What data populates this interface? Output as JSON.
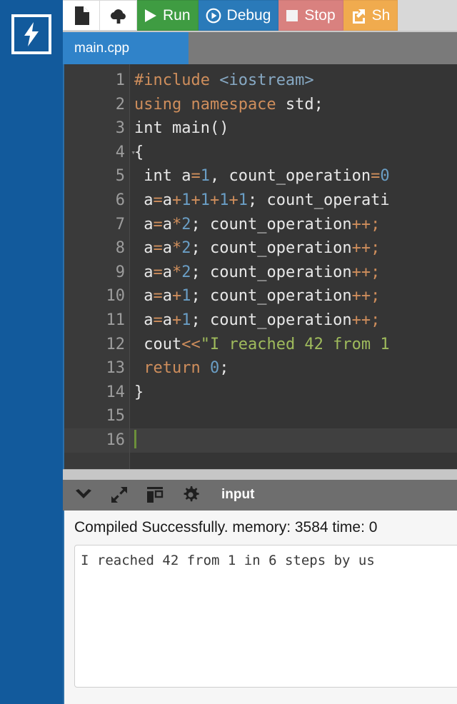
{
  "app": {
    "logo_icon": "lightning-bolt-icon",
    "sidebar_color": "#125a9c"
  },
  "toolbar": {
    "new_file_icon": "new-file-icon",
    "upload_icon": "cloud-upload-icon",
    "run_label": "Run",
    "run_icon": "play-icon",
    "run_color": "#3f9c42",
    "debug_label": "Debug",
    "debug_icon": "debug-circle-play-icon",
    "debug_color": "#2a7ab9",
    "stop_label": "Stop",
    "stop_icon": "stop-square-icon",
    "stop_color": "#d9817f",
    "share_label": "Sh",
    "share_icon": "share-external-icon",
    "share_color": "#f0ab4e"
  },
  "tabs": [
    {
      "label": "main.cpp",
      "active": true
    }
  ],
  "editor": {
    "lines": [
      {
        "num": "1",
        "fold": false,
        "active": false,
        "tokens": [
          {
            "t": "#include ",
            "c": "k"
          },
          {
            "t": "<iostream>",
            "c": "inc"
          }
        ]
      },
      {
        "num": "2",
        "fold": false,
        "active": false,
        "tokens": [
          {
            "t": "using namespace ",
            "c": "k"
          },
          {
            "t": "std;",
            "c": "pl"
          }
        ]
      },
      {
        "num": "3",
        "fold": false,
        "active": false,
        "tokens": [
          {
            "t": "int main()",
            "c": "pl"
          }
        ]
      },
      {
        "num": "4",
        "fold": true,
        "active": false,
        "tokens": [
          {
            "t": "{",
            "c": "pl"
          }
        ]
      },
      {
        "num": "5",
        "fold": false,
        "active": false,
        "tokens": [
          {
            "t": " int a",
            "c": "pl"
          },
          {
            "t": "=",
            "c": "k"
          },
          {
            "t": "1",
            "c": "n"
          },
          {
            "t": ", count_operation",
            "c": "pl"
          },
          {
            "t": "=",
            "c": "k"
          },
          {
            "t": "0",
            "c": "n"
          }
        ]
      },
      {
        "num": "6",
        "fold": false,
        "active": false,
        "tokens": [
          {
            "t": " a",
            "c": "pl"
          },
          {
            "t": "=",
            "c": "k"
          },
          {
            "t": "a",
            "c": "pl"
          },
          {
            "t": "+",
            "c": "k"
          },
          {
            "t": "1",
            "c": "n"
          },
          {
            "t": "+",
            "c": "k"
          },
          {
            "t": "1",
            "c": "n"
          },
          {
            "t": "+",
            "c": "k"
          },
          {
            "t": "1",
            "c": "n"
          },
          {
            "t": "+",
            "c": "k"
          },
          {
            "t": "1",
            "c": "n"
          },
          {
            "t": "; count_operati",
            "c": "pl"
          }
        ]
      },
      {
        "num": "7",
        "fold": false,
        "active": false,
        "tokens": [
          {
            "t": " a",
            "c": "pl"
          },
          {
            "t": "=",
            "c": "k"
          },
          {
            "t": "a",
            "c": "pl"
          },
          {
            "t": "*",
            "c": "k"
          },
          {
            "t": "2",
            "c": "n"
          },
          {
            "t": "; count_operation",
            "c": "pl"
          },
          {
            "t": "++;",
            "c": "k"
          }
        ]
      },
      {
        "num": "8",
        "fold": false,
        "active": false,
        "tokens": [
          {
            "t": " a",
            "c": "pl"
          },
          {
            "t": "=",
            "c": "k"
          },
          {
            "t": "a",
            "c": "pl"
          },
          {
            "t": "*",
            "c": "k"
          },
          {
            "t": "2",
            "c": "n"
          },
          {
            "t": "; count_operation",
            "c": "pl"
          },
          {
            "t": "++;",
            "c": "k"
          }
        ]
      },
      {
        "num": "9",
        "fold": false,
        "active": false,
        "tokens": [
          {
            "t": " a",
            "c": "pl"
          },
          {
            "t": "=",
            "c": "k"
          },
          {
            "t": "a",
            "c": "pl"
          },
          {
            "t": "*",
            "c": "k"
          },
          {
            "t": "2",
            "c": "n"
          },
          {
            "t": "; count_operation",
            "c": "pl"
          },
          {
            "t": "++;",
            "c": "k"
          }
        ]
      },
      {
        "num": "10",
        "fold": false,
        "active": false,
        "tokens": [
          {
            "t": " a",
            "c": "pl"
          },
          {
            "t": "=",
            "c": "k"
          },
          {
            "t": "a",
            "c": "pl"
          },
          {
            "t": "+",
            "c": "k"
          },
          {
            "t": "1",
            "c": "n"
          },
          {
            "t": "; count_operation",
            "c": "pl"
          },
          {
            "t": "++;",
            "c": "k"
          }
        ]
      },
      {
        "num": "11",
        "fold": false,
        "active": false,
        "tokens": [
          {
            "t": " a",
            "c": "pl"
          },
          {
            "t": "=",
            "c": "k"
          },
          {
            "t": "a",
            "c": "pl"
          },
          {
            "t": "+",
            "c": "k"
          },
          {
            "t": "1",
            "c": "n"
          },
          {
            "t": "; count_operation",
            "c": "pl"
          },
          {
            "t": "++;",
            "c": "k"
          }
        ]
      },
      {
        "num": "12",
        "fold": false,
        "active": false,
        "tokens": [
          {
            "t": " cout",
            "c": "pl"
          },
          {
            "t": "<<",
            "c": "k"
          },
          {
            "t": "\"I reached 42 from 1",
            "c": "s"
          }
        ]
      },
      {
        "num": "13",
        "fold": false,
        "active": false,
        "tokens": [
          {
            "t": " return ",
            "c": "k"
          },
          {
            "t": "0",
            "c": "n"
          },
          {
            "t": ";",
            "c": "pl"
          }
        ]
      },
      {
        "num": "14",
        "fold": false,
        "active": false,
        "tokens": [
          {
            "t": "}",
            "c": "pl"
          }
        ]
      },
      {
        "num": "15",
        "fold": false,
        "active": false,
        "tokens": []
      },
      {
        "num": "16",
        "fold": false,
        "active": true,
        "caret": true,
        "tokens": []
      }
    ]
  },
  "console": {
    "collapse_icon": "chevron-down-icon",
    "expand_icon": "expand-arrows-icon",
    "layout_icon": "panel-layout-icon",
    "settings_icon": "gear-icon",
    "title": "input",
    "status": "Compiled Successfully. memory: 3584 time: 0",
    "output": "I reached 42 from 1 in 6 steps by us"
  }
}
